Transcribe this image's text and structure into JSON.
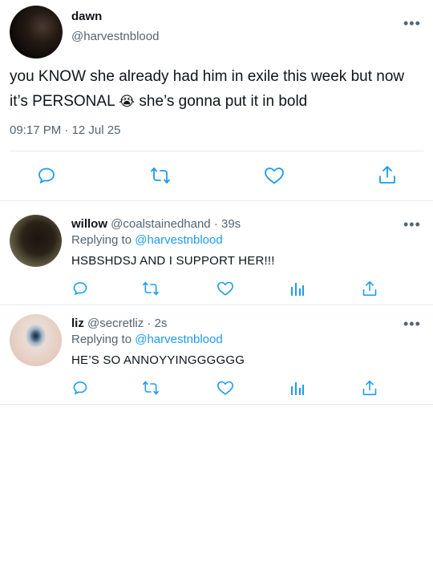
{
  "colors": {
    "accent": "#1d9bf0",
    "muted": "#536471",
    "divider": "#e6ecf0"
  },
  "main_tweet": {
    "name": "dawn",
    "handle": "@harvestnblood",
    "text_part1": "you KNOW she already had him in exile this week but now it’s PERSONAL ",
    "emoji": "😭",
    "text_part2": " she’s gonna put it in bold",
    "time": "09:17 PM",
    "sep": " · ",
    "date": "12 Jul 25",
    "more": "•••",
    "actions": [
      "reply-icon",
      "retweet-icon",
      "like-icon",
      "share-icon"
    ]
  },
  "replies": [
    {
      "name": "willow",
      "handle": "@coalstainedhand",
      "time": " · 39s",
      "replying_label": "Replying to ",
      "replying_to": "@harvestnblood",
      "text": "HSBSHDSJ AND I SUPPORT HER!!!",
      "more": "•••"
    },
    {
      "name": "liz",
      "handle": "@secretliz",
      "time": " · 2s",
      "replying_label": "Replying to ",
      "replying_to": "@harvestnblood",
      "text": "HE’S SO ANNOYYINGGGGGG",
      "more": "•••"
    }
  ]
}
